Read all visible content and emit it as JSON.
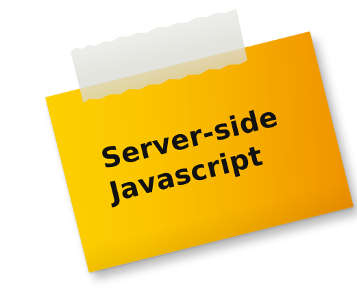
{
  "note": {
    "line1": "Server-side",
    "line2": "Javascript"
  },
  "colors": {
    "note_light": "#fdd000",
    "note_dark": "#ee9200",
    "tape": "#e2e2dc",
    "text": "#111111"
  }
}
